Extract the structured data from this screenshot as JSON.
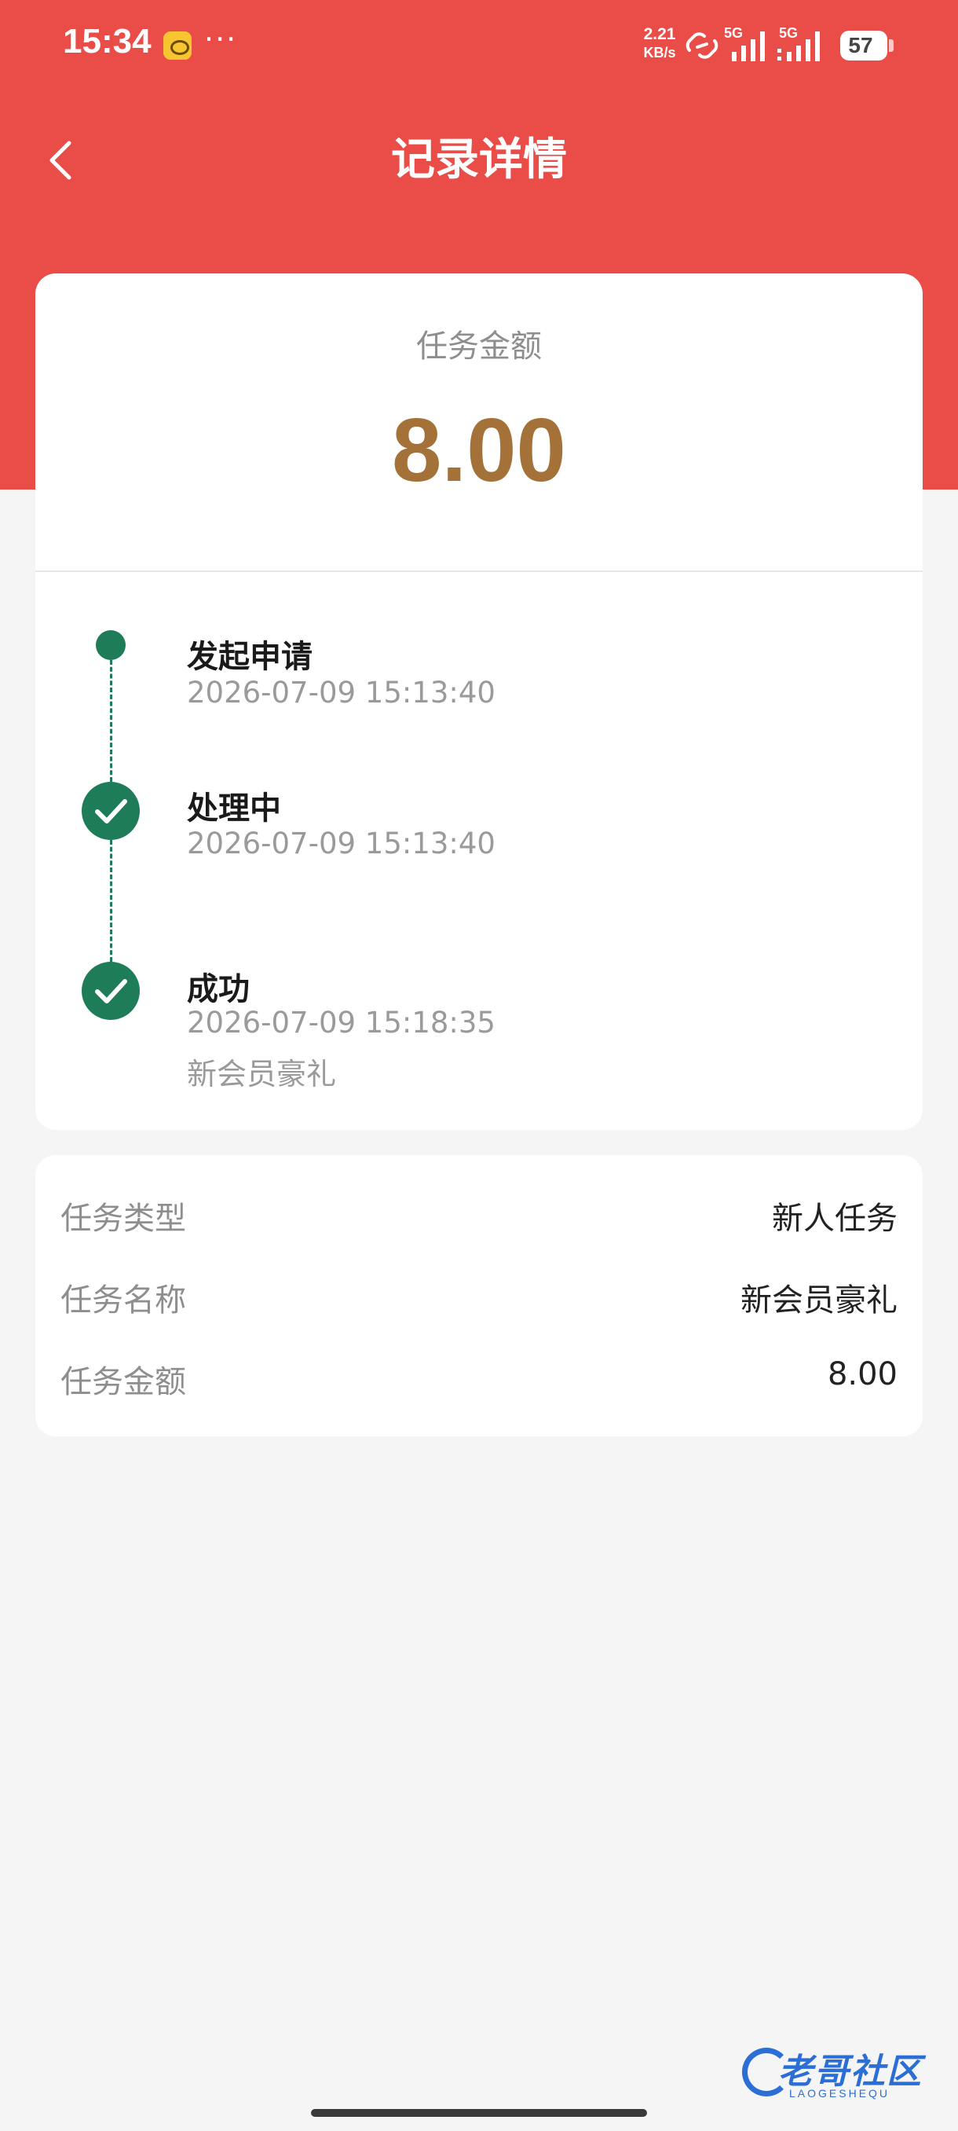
{
  "status_bar": {
    "time": "15:34",
    "dots": "···",
    "net_speed_value": "2.21",
    "net_speed_unit": "KB/s",
    "sim1_label": "5G",
    "sim2_label": "5G",
    "battery": "57"
  },
  "nav": {
    "title": "记录详情"
  },
  "summary": {
    "label": "任务金额",
    "amount": "8.00"
  },
  "timeline": [
    {
      "title": "发起申请",
      "time": "2026-07-09 15:13:40"
    },
    {
      "title": "处理中",
      "time": "2026-07-09 15:13:40"
    },
    {
      "title": "成功",
      "time": "2026-07-09 15:18:35",
      "note": "新会员豪礼"
    }
  ],
  "details": [
    {
      "label": "任务类型",
      "value": "新人任务"
    },
    {
      "label": "任务名称",
      "value": "新会员豪礼"
    },
    {
      "label": "任务金额",
      "value": "8.00"
    }
  ],
  "watermark": {
    "text": "老哥社区",
    "sub": "LAOGESHEQU"
  },
  "colors": {
    "header_red": "#ea4d47",
    "amount_gold": "#a47239",
    "timeline_green": "#1f7c59",
    "watermark_blue": "#2b6ed6"
  }
}
